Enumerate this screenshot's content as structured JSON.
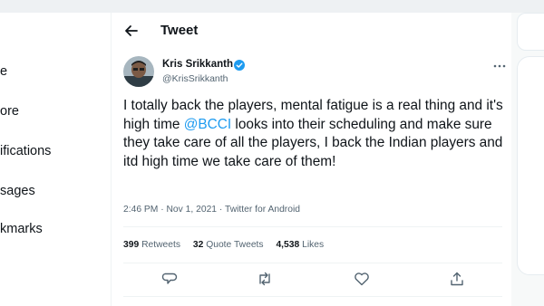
{
  "nav": {
    "items": [
      {
        "label": "e"
      },
      {
        "label": "ore"
      },
      {
        "label": "ifications"
      },
      {
        "label": "sages"
      },
      {
        "label": "kmarks"
      }
    ]
  },
  "header": {
    "title": "Tweet"
  },
  "tweet": {
    "author_name": "Kris Srikkanth",
    "author_handle": "@KrisSrikkanth",
    "text_before": "I totally back the players, mental fatigue is a real thing and it's high time ",
    "mention": "@BCCI",
    "text_after": " looks into their scheduling and make sure they take care of all the players, I back the Indian players and itd high time we take care of them!",
    "meta": "2:46 PM · Nov 1, 2021 · Twitter for Android",
    "stats": {
      "retweets_count": "399",
      "retweets_label": "Retweets",
      "quotes_count": "32",
      "quotes_label": "Quote Tweets",
      "likes_count": "4,538",
      "likes_label": "Likes"
    }
  },
  "icons": {
    "back": "arrow-left-icon",
    "verified": "verified-badge-icon",
    "more": "more-dots-icon",
    "reply": "reply-icon",
    "retweet": "retweet-icon",
    "like": "heart-icon",
    "share": "share-icon"
  },
  "colors": {
    "accent": "#1d9bf0",
    "text": "#0f1419",
    "secondary": "#536471"
  }
}
